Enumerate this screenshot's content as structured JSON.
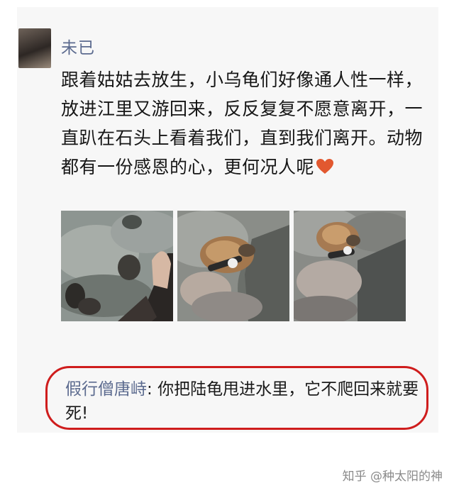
{
  "post": {
    "author": "未已",
    "text": "跟着姑姑去放生，小乌龟们好像通人性一样，放进江里又游回来，反反复复不愿意离开，一直趴在石头上看着我们，直到我们离开。动物都有一份感恩的心，更何况人呢",
    "emoji": "heart-emoji",
    "photos": [
      "turtle-photo-1",
      "turtle-photo-2",
      "turtle-photo-3"
    ]
  },
  "comment": {
    "author": "假行僧唐峙",
    "separator": ": ",
    "text": "你把陆龟甩进水里，它不爬回来就要死!"
  },
  "annotation": {
    "color": "#cf1d1d"
  },
  "watermark": "知乎 @种太阳的神"
}
